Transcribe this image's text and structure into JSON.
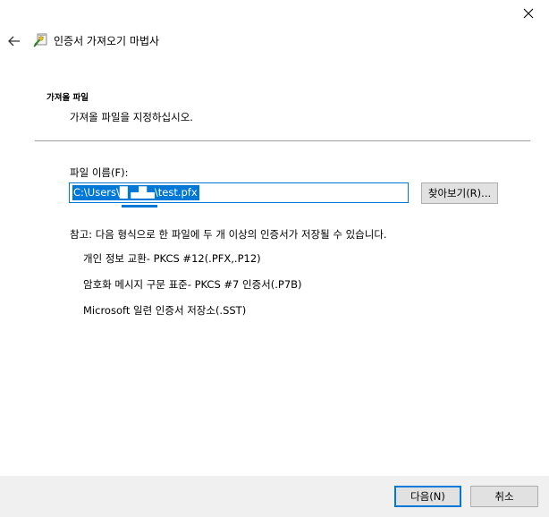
{
  "window": {
    "title": "인증서 가져오기 마법사",
    "close_glyph": "✕",
    "back_glyph": "←"
  },
  "section": {
    "title": "가져올 파일",
    "description": "가져올 파일을 지정하십시오."
  },
  "file": {
    "label": "파일 이름(F):",
    "value": "C:\\Users\\█ ▄█▄\\test.pfx",
    "browse_label": "찾아보기(R)..."
  },
  "note": {
    "text": "참고: 다음 형식으로 한 파일에 두 개 이상의 인증서가 저장될 수 있습니다.",
    "formats": [
      "개인 정보 교환- PKCS #12(.PFX,.P12)",
      "암호화 메시지 구문 표준- PKCS #7 인증서(.P7B)",
      "Microsoft 일련 인증서 저장소(.SST)"
    ]
  },
  "footer": {
    "next_label": "다음(N)",
    "cancel_label": "취소"
  },
  "colors": {
    "accent": "#0078d7",
    "footer_bg": "#f0f0f0",
    "button_bg": "#e1e1e1"
  },
  "icons": {
    "close": "close-icon",
    "back": "back-arrow-icon",
    "wizard": "certificate-wizard-icon"
  }
}
